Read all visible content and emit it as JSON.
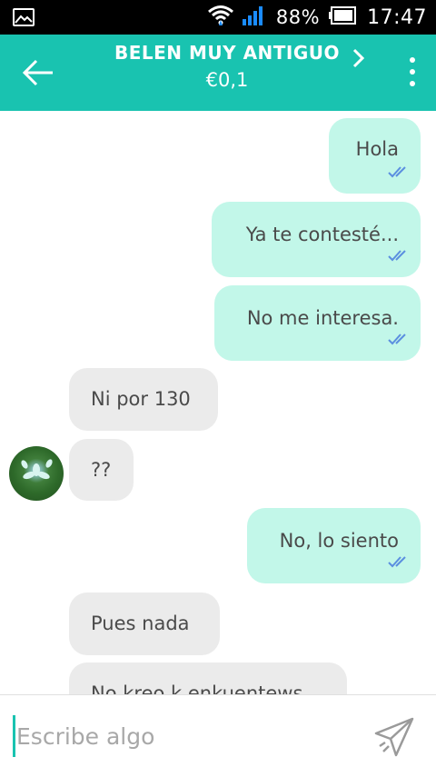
{
  "status_bar": {
    "battery": "88%",
    "time": "17:47"
  },
  "header": {
    "title": "BELEN MUY ANTIGUO",
    "price": "€0,1"
  },
  "messages": [
    {
      "direction": "out",
      "text": "Hola",
      "read": true
    },
    {
      "direction": "out",
      "text": "Ya te contesté...",
      "read": true
    },
    {
      "direction": "out",
      "text": "No me interesa.",
      "read": true
    },
    {
      "direction": "in",
      "text": "Ni por 130"
    },
    {
      "direction": "in",
      "text": "??"
    },
    {
      "direction": "out",
      "text": "No, lo siento",
      "read": true
    },
    {
      "direction": "in",
      "text": "Pues nada"
    },
    {
      "direction": "in",
      "text": "No kreo k enkuentews"
    }
  ],
  "composer": {
    "placeholder": "Escribe algo"
  },
  "colors": {
    "accent": "#19c3b0",
    "outgoing_bubble": "#c2f7e9",
    "incoming_bubble": "#ebebeb",
    "read_ticks": "#5b8fe0"
  },
  "icons": {
    "gallery": "gallery-icon",
    "wifi": "wifi-icon",
    "signal": "signal-icon",
    "battery": "battery-icon",
    "back": "back-arrow-icon",
    "title_chevron": "chevron-right-icon",
    "more": "more-vert-icon",
    "read": "double-check-icon",
    "send": "send-icon"
  }
}
